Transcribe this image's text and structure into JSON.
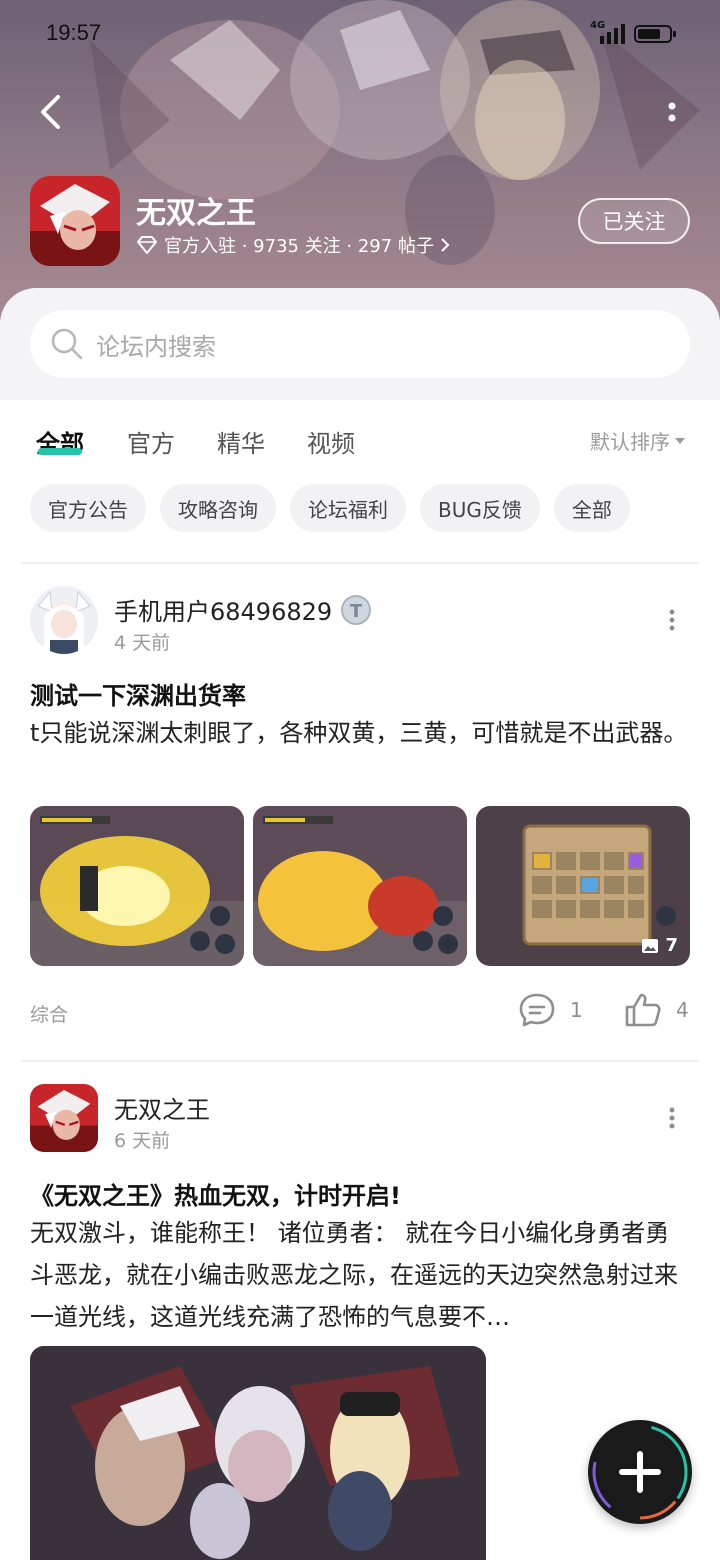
{
  "status_bar": {
    "time": "19:57",
    "network": "4G"
  },
  "forum": {
    "name": "无双之王",
    "meta": "官方入驻 · 9735 关注 · 297 帖子",
    "follow_label": "已关注"
  },
  "search": {
    "placeholder": "论坛内搜索"
  },
  "tabs": [
    {
      "label": "全部",
      "active": true
    },
    {
      "label": "官方",
      "active": false
    },
    {
      "label": "精华",
      "active": false
    },
    {
      "label": "视频",
      "active": false
    }
  ],
  "sort_label": "默认排序",
  "chips": [
    "官方公告",
    "攻略咨询",
    "论坛福利",
    "BUG反馈",
    "全部"
  ],
  "posts": [
    {
      "author": "手机用户68496829",
      "badge": "T",
      "time": "4 天前",
      "title": "测试一下深渊出货率",
      "body": "t只能说深渊太刺眼了，各种双黄，三黄，可惜就是不出武器。",
      "image_count": "7",
      "tag": "综合",
      "comments": "1",
      "likes": "4"
    },
    {
      "author": "无双之王",
      "time": "6 天前",
      "title": "《无双之王》热血无双，计时开启!",
      "body": "无双激斗，谁能称王！ 诸位勇者： 就在今日小编化身勇者勇斗恶龙，就在小编击败恶龙之际，在遥远的天边突然急射过来一道光线，这道光线充满了恐怖的气息要不…"
    }
  ],
  "colors": {
    "accent": "#27c3a8",
    "header_bg": "#8a7785"
  }
}
